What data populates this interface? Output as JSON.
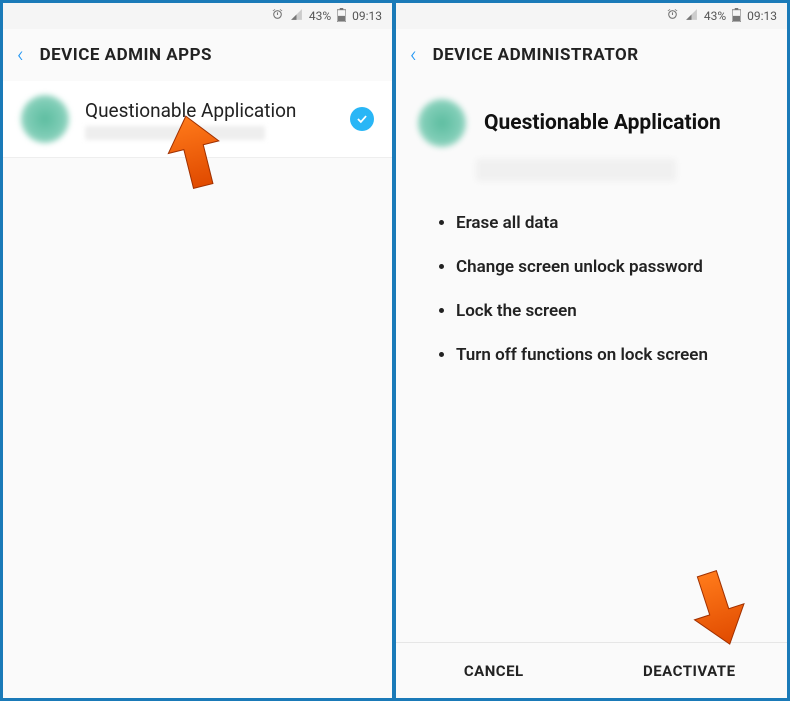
{
  "statusbar": {
    "battery_pct": "43%",
    "time": "09:13"
  },
  "left": {
    "title": "DEVICE ADMIN APPS",
    "app_name": "Questionable Application"
  },
  "right": {
    "title": "DEVICE ADMINISTRATOR",
    "app_name": "Questionable Application",
    "perms": {
      "0": "Erase all data",
      "1": "Change screen unlock password",
      "2": "Lock the screen",
      "3": "Turn off functions on lock screen"
    },
    "cancel": "CANCEL",
    "deactivate": "DEACTIVATE"
  }
}
